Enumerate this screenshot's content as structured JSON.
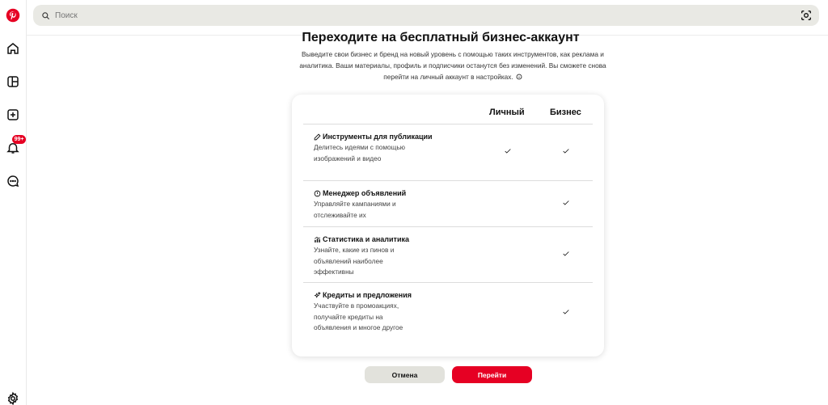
{
  "colors": {
    "brand": "#e60023",
    "search_bg": "#e9e9e4",
    "cancel_bg": "#e2e2dc"
  },
  "sidebar": {
    "items": [
      {
        "icon": "pinterest-logo-icon"
      },
      {
        "icon": "home-icon"
      },
      {
        "icon": "explore-icon"
      },
      {
        "icon": "create-icon"
      },
      {
        "icon": "notifications-icon",
        "badge": "99+"
      },
      {
        "icon": "messages-icon"
      },
      {
        "icon": "settings-icon"
      }
    ]
  },
  "search": {
    "placeholder": "Поиск",
    "camera_icon": "camera-search-icon"
  },
  "main": {
    "title": "Переходите на бесплатный бизнес-аккаунт",
    "description": "Выведите свои бизнес и бренд на новый уровень с помощью таких инструментов, как реклама и аналитика. Ваши материалы, профиль и подписчики останутся без изменений. Вы сможете снова перейти на личный аккаунт в настройках.",
    "info_icon": "info-icon"
  },
  "comparison": {
    "columns": {
      "personal": "Личный",
      "business": "Бизнес"
    },
    "features": [
      {
        "icon": "pencil-icon",
        "title": "Инструменты для публикации",
        "description": "Делитесь идеями с помощью изображений и видео",
        "personal": true,
        "business": true
      },
      {
        "icon": "alert-circle-icon",
        "title": "Менеджер объявлений",
        "description": "Управляйте кампаниями и отслеживайте их",
        "personal": false,
        "business": true
      },
      {
        "icon": "analytics-icon",
        "title": "Статистика и аналитика",
        "description": "Узнайте, какие из пинов и объявлений наиболее эффективны",
        "personal": false,
        "business": true
      },
      {
        "icon": "sparkle-icon",
        "title": "Кредиты и предложения",
        "description": "Участвуйте в промоакциях, получайте кредиты на объявления и многое другое",
        "personal": false,
        "business": true
      }
    ]
  },
  "actions": {
    "cancel": "Отмена",
    "go": "Перейти"
  }
}
